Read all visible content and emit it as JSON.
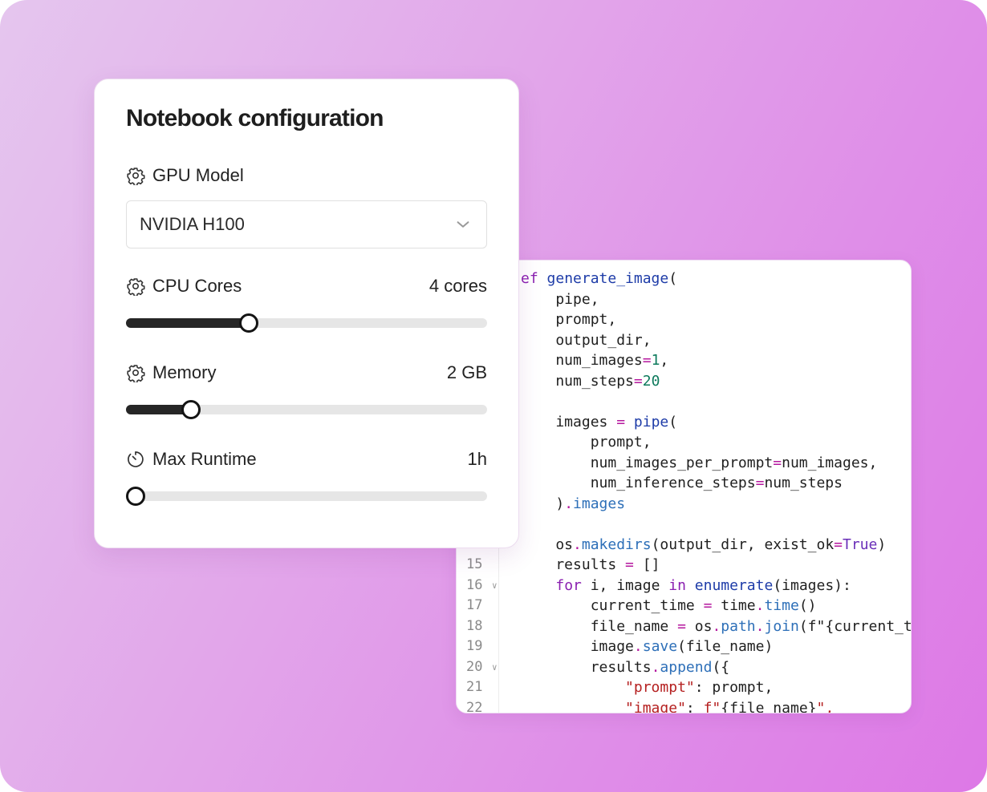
{
  "config_panel": {
    "title": "Notebook configuration",
    "gpu_model": {
      "label": "GPU Model",
      "icon": "gear-icon",
      "selected": "NVIDIA H100"
    },
    "cpu_cores": {
      "label": "CPU Cores",
      "icon": "gear-icon",
      "value_text": "4 cores",
      "fraction": 0.34
    },
    "memory": {
      "label": "Memory",
      "icon": "gear-icon",
      "value_text": "2 GB",
      "fraction": 0.18
    },
    "max_runtime": {
      "label": "Max Runtime",
      "icon": "timer-icon",
      "value_text": "1h",
      "fraction": 0.02
    }
  },
  "code_editor": {
    "lines": [
      {
        "n": "",
        "fold": false,
        "tokens": [
          [
            "ef ",
            "kw"
          ],
          [
            "generate_image",
            "fn"
          ],
          [
            "(",
            "plain"
          ]
        ]
      },
      {
        "n": "",
        "fold": false,
        "tokens": [
          [
            "    pipe,",
            "plain"
          ]
        ]
      },
      {
        "n": "",
        "fold": false,
        "tokens": [
          [
            "    prompt,",
            "plain"
          ]
        ]
      },
      {
        "n": "",
        "fold": false,
        "tokens": [
          [
            "    output_dir,",
            "plain"
          ]
        ]
      },
      {
        "n": "",
        "fold": false,
        "tokens": [
          [
            "    num_images",
            "plain"
          ],
          [
            "=",
            "op"
          ],
          [
            "1",
            "num"
          ],
          [
            ",",
            "plain"
          ]
        ]
      },
      {
        "n": "",
        "fold": false,
        "tokens": [
          [
            "    num_steps",
            "plain"
          ],
          [
            "=",
            "op"
          ],
          [
            "20",
            "num"
          ]
        ]
      },
      {
        "n": "",
        "fold": false,
        "tokens": [
          [
            "",
            "plain"
          ]
        ]
      },
      {
        "n": "",
        "fold": false,
        "tokens": [
          [
            "    images ",
            "plain"
          ],
          [
            "=",
            "op"
          ],
          [
            " ",
            "plain"
          ],
          [
            "pipe",
            "fn"
          ],
          [
            "(",
            "plain"
          ]
        ]
      },
      {
        "n": "",
        "fold": false,
        "tokens": [
          [
            "        prompt,",
            "plain"
          ]
        ]
      },
      {
        "n": "",
        "fold": false,
        "tokens": [
          [
            "        num_images_per_prompt",
            "plain"
          ],
          [
            "=",
            "op"
          ],
          [
            "num_images,",
            "plain"
          ]
        ]
      },
      {
        "n": "",
        "fold": false,
        "tokens": [
          [
            "        num_inference_steps",
            "plain"
          ],
          [
            "=",
            "op"
          ],
          [
            "num_steps",
            "plain"
          ]
        ]
      },
      {
        "n": "",
        "fold": false,
        "tokens": [
          [
            "    )",
            "plain"
          ],
          [
            ".",
            "op"
          ],
          [
            "images",
            "attr"
          ]
        ]
      },
      {
        "n": "",
        "fold": false,
        "tokens": [
          [
            "",
            "plain"
          ]
        ]
      },
      {
        "n": "",
        "fold": false,
        "tokens": [
          [
            "    os",
            "plain"
          ],
          [
            ".",
            "op"
          ],
          [
            "makedirs",
            "attr"
          ],
          [
            "(output_dir, exist_ok",
            "plain"
          ],
          [
            "=",
            "op"
          ],
          [
            "True",
            "const"
          ],
          [
            ")",
            "plain"
          ]
        ]
      },
      {
        "n": "15",
        "fold": false,
        "tokens": [
          [
            "    results ",
            "plain"
          ],
          [
            "=",
            "op"
          ],
          [
            " []",
            "plain"
          ]
        ]
      },
      {
        "n": "16",
        "fold": true,
        "tokens": [
          [
            "    ",
            "plain"
          ],
          [
            "for",
            "kw"
          ],
          [
            " i, image ",
            "plain"
          ],
          [
            "in",
            "kw"
          ],
          [
            " ",
            "plain"
          ],
          [
            "enumerate",
            "fn"
          ],
          [
            "(images):",
            "plain"
          ]
        ]
      },
      {
        "n": "17",
        "fold": false,
        "tokens": [
          [
            "        current_time ",
            "plain"
          ],
          [
            "=",
            "op"
          ],
          [
            " time",
            "plain"
          ],
          [
            ".",
            "op"
          ],
          [
            "time",
            "attr"
          ],
          [
            "()",
            "plain"
          ]
        ]
      },
      {
        "n": "18",
        "fold": false,
        "tokens": [
          [
            "        file_name ",
            "plain"
          ],
          [
            "=",
            "op"
          ],
          [
            " os",
            "plain"
          ],
          [
            ".",
            "op"
          ],
          [
            "path",
            "attr"
          ],
          [
            ".",
            "op"
          ],
          [
            "join",
            "attr"
          ],
          [
            "(f\"{current_tim",
            "plain"
          ]
        ]
      },
      {
        "n": "19",
        "fold": false,
        "tokens": [
          [
            "        image",
            "plain"
          ],
          [
            ".",
            "op"
          ],
          [
            "save",
            "attr"
          ],
          [
            "(file_name)",
            "plain"
          ]
        ]
      },
      {
        "n": "20",
        "fold": true,
        "tokens": [
          [
            "        results",
            "plain"
          ],
          [
            ".",
            "op"
          ],
          [
            "append",
            "attr"
          ],
          [
            "({",
            "plain"
          ]
        ]
      },
      {
        "n": "21",
        "fold": false,
        "tokens": [
          [
            "            ",
            "plain"
          ],
          [
            "\"prompt\"",
            "str"
          ],
          [
            ": prompt,",
            "plain"
          ]
        ]
      },
      {
        "n": "22",
        "fold": false,
        "tokens": [
          [
            "            ",
            "plain"
          ],
          [
            "\"image\"",
            "str"
          ],
          [
            ": ",
            "plain"
          ],
          [
            "f\"",
            "str"
          ],
          [
            "{file_name}",
            "plain"
          ],
          [
            "\",",
            "str"
          ]
        ]
      }
    ]
  }
}
